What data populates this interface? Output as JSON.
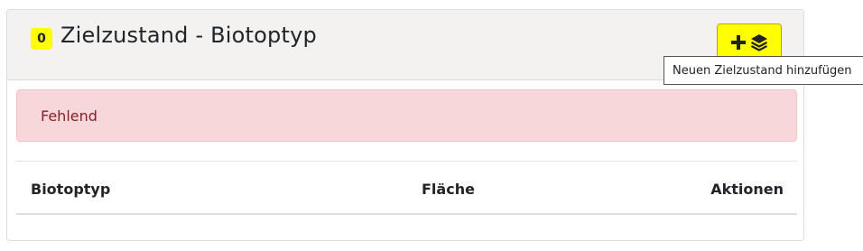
{
  "section": {
    "count_badge": "0",
    "title": "Zielzustand - Biotoptyp",
    "add_button": {
      "icons": [
        "plus-icon",
        "layers-icon"
      ],
      "tooltip": "Neuen Zielzustand hinzufügen"
    },
    "alert": "Fehlend",
    "table": {
      "columns": [
        "Biotoptyp",
        "Fläche",
        "Aktionen"
      ]
    }
  },
  "colors": {
    "accent_yellow": "#ffff00",
    "header_bg": "#f3f2f1",
    "alert_bg": "#f8d7da",
    "alert_text": "#842029"
  }
}
